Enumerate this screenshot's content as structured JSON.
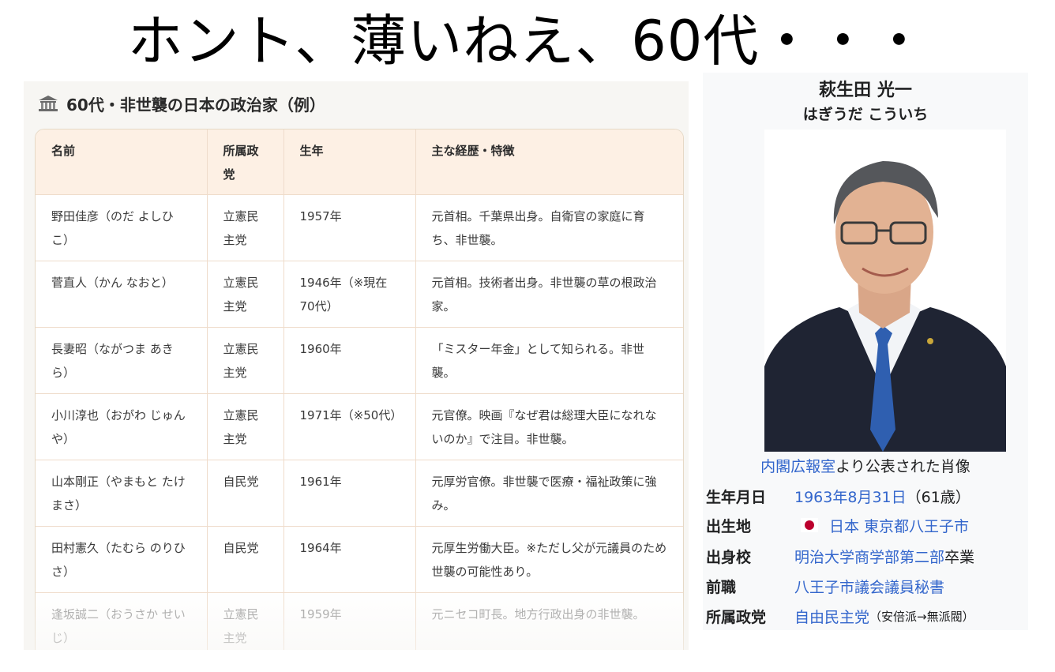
{
  "headline": "ホント、薄いねえ、60代・・・",
  "left_panel": {
    "title_icon": "bank-icon",
    "title": "60代・非世襲の日本の政治家（例）",
    "columns": [
      "名前",
      "所属政党",
      "生年",
      "主な経歴・特徴"
    ],
    "rows": [
      {
        "name": "野田佳彦（のだ よしひこ）",
        "party": "立憲民主党",
        "born": "1957年",
        "notes": "元首相。千葉県出身。自衛官の家庭に育ち、非世襲。"
      },
      {
        "name": "菅直人（かん なおと）",
        "party": "立憲民主党",
        "born": "1946年（※現在70代）",
        "notes": "元首相。技術者出身。非世襲の草の根政治家。"
      },
      {
        "name": "長妻昭（ながつま あきら）",
        "party": "立憲民主党",
        "born": "1960年",
        "notes": "「ミスター年金」として知られる。非世襲。"
      },
      {
        "name": "小川淳也（おがわ じゅんや）",
        "party": "立憲民主党",
        "born": "1971年（※50代）",
        "notes": "元官僚。映画『なぜ君は総理大臣になれないのか』で注目。非世襲。"
      },
      {
        "name": "山本剛正（やまもと たけまさ）",
        "party": "自民党",
        "born": "1961年",
        "notes": "元厚労官僚。非世襲で医療・福祉政策に強み。"
      },
      {
        "name": "田村憲久（たむら のりひさ）",
        "party": "自民党",
        "born": "1964年",
        "notes": "元厚生労働大臣。※ただし父が元議員のため世襲の可能性あり。"
      },
      {
        "name": "逢坂誠二（おうさか せいじ）",
        "party": "立憲民主党",
        "born": "1959年",
        "notes": "元ニセコ町長。地方行政出身の非世襲。"
      }
    ]
  },
  "right_panel": {
    "name": "萩生田 光一",
    "reading": "はぎうだ こういち",
    "caption_link": "内閣広報室",
    "caption_rest": "より公表された肖像",
    "info": {
      "birth_label": "生年月日",
      "birth_date": "1963年8月31日",
      "birth_age": "（61歳）",
      "birthplace_label": "出生地",
      "flag_icon": "japan-flag-icon",
      "birthplace": "日本 東京都八王子市",
      "school_label": "出身校",
      "school_link": "明治大学商学部第二部",
      "school_suffix": "卒業",
      "prev_job_label": "前職",
      "prev_job": "八王子市議会議員秘書",
      "party_label": "所属政党",
      "party": "自由民主党",
      "faction": "（安倍派→無派閥）"
    }
  },
  "colors": {
    "table_header_bg": "#fdf0e4",
    "table_border": "#efdccb",
    "link": "#3366cc",
    "flag_red": "#bc002d"
  }
}
